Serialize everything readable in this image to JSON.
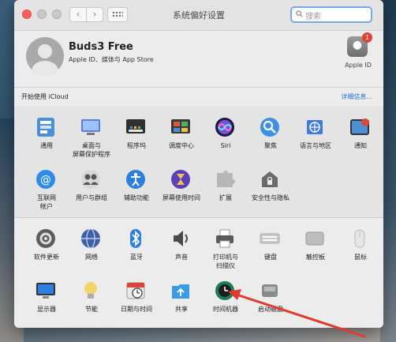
{
  "window": {
    "title": "系统偏好设置"
  },
  "search": {
    "placeholder": "搜索"
  },
  "account": {
    "name": "Buds3 Free",
    "subtitle": "Apple ID、媒体与 App Store",
    "apple_id_label": "Apple ID",
    "apple_id_badge": "1"
  },
  "icloud": {
    "prompt": "开始使用 iCloud",
    "details_link": "详细信息..."
  },
  "section1": [
    {
      "label": "通用",
      "icon": "general-icon",
      "color": "#4a90d9"
    },
    {
      "label": "桌面与\n屏幕保护程序",
      "icon": "desktop-icon",
      "color": "#5b7fd6"
    },
    {
      "label": "程序坞",
      "icon": "dock-icon",
      "color": "#2f2f2f"
    },
    {
      "label": "调度中心",
      "icon": "mission-control-icon",
      "color": "#3a3a3a"
    },
    {
      "label": "Siri",
      "icon": "siri-icon",
      "color": "#7a4fd6"
    },
    {
      "label": "聚焦",
      "icon": "spotlight-icon",
      "color": "#3d8ee6"
    },
    {
      "label": "语言与地区",
      "icon": "language-icon",
      "color": "#3f7ae0"
    },
    {
      "label": "通知",
      "icon": "notifications-icon",
      "color": "#d94a3a"
    },
    {
      "label": "互联网\n帐户",
      "icon": "internet-accounts-icon",
      "color": "#2e8be6"
    },
    {
      "label": "用户与群组",
      "icon": "users-groups-icon",
      "color": "#8a8a8a"
    },
    {
      "label": "辅助功能",
      "icon": "accessibility-icon",
      "color": "#2c7fe0"
    },
    {
      "label": "屏幕使用时间",
      "icon": "screen-time-icon",
      "color": "#5b3fb8"
    },
    {
      "label": "扩展",
      "icon": "extensions-icon",
      "color": "#b7b7b7"
    },
    {
      "label": "安全性与隐私",
      "icon": "security-icon",
      "color": "#6b6b6b"
    }
  ],
  "section2": [
    {
      "label": "软件更新",
      "icon": "software-update-icon",
      "color": "#5c5c5c"
    },
    {
      "label": "网络",
      "icon": "network-icon",
      "color": "#3d5fa8"
    },
    {
      "label": "蓝牙",
      "icon": "bluetooth-icon",
      "color": "#2d7fe6"
    },
    {
      "label": "声音",
      "icon": "sound-icon",
      "color": "#4a4a4a"
    },
    {
      "label": "打印机与\n扫描仪",
      "icon": "printers-icon",
      "color": "#5a5a5a"
    },
    {
      "label": "键盘",
      "icon": "keyboard-icon",
      "color": "#c9c9c9"
    },
    {
      "label": "触控板",
      "icon": "trackpad-icon",
      "color": "#bdbdbd"
    },
    {
      "label": "鼠标",
      "icon": "mouse-icon",
      "color": "#e6e6e6"
    },
    {
      "label": "显示器",
      "icon": "displays-icon",
      "color": "#2f7fe0"
    },
    {
      "label": "节能",
      "icon": "energy-saver-icon",
      "color": "#f2d36b"
    },
    {
      "label": "日期与时间",
      "icon": "date-time-icon",
      "color": "#e9e9e9"
    },
    {
      "label": "共享",
      "icon": "sharing-icon",
      "color": "#3a9be6"
    },
    {
      "label": "时间机器",
      "icon": "time-machine-icon",
      "color": "#1f7a5a"
    },
    {
      "label": "启动磁盘",
      "icon": "startup-disk-icon",
      "color": "#8a8a8a"
    }
  ]
}
